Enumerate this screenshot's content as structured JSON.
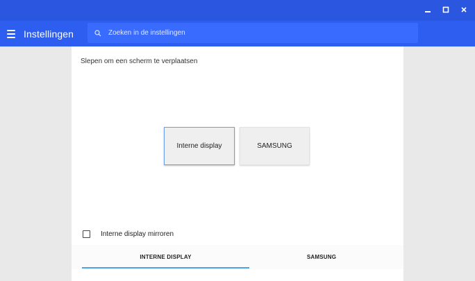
{
  "window": {
    "controls": [
      "minimize-icon",
      "maximize-icon",
      "close-icon"
    ]
  },
  "toolbar": {
    "title": "Instellingen",
    "search_placeholder": "Zoeken in de instellingen"
  },
  "display_arrangement": {
    "hint": "Slepen om een scherm te verplaatsen",
    "displays": [
      "Interne display",
      "SAMSUNG"
    ]
  },
  "mirror": {
    "label": "Interne display mirroren",
    "checked": false
  },
  "tabs": {
    "items": [
      "INTERNE DISPLAY",
      "SAMSUNG"
    ],
    "selected": 0
  },
  "colors": {
    "titlebar": "#2a56e0",
    "toolbar": "#2e5ef0",
    "accent": "#4aa3e6"
  }
}
